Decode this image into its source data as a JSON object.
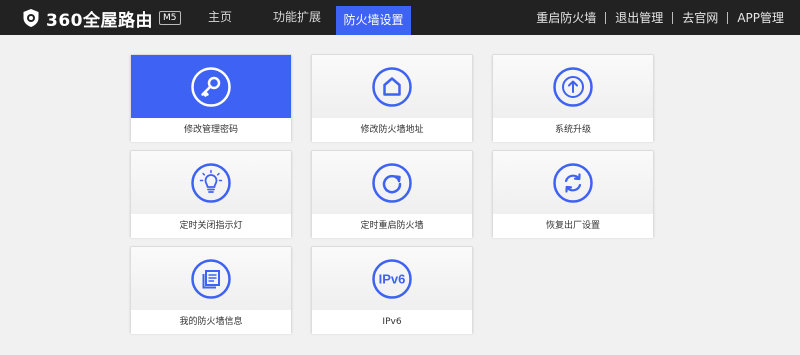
{
  "brand": {
    "name": "360全屋路由",
    "model": "M5"
  },
  "nav": {
    "items": [
      {
        "label": "主页",
        "active": false
      },
      {
        "label": "功能扩展",
        "active": false
      },
      {
        "label": "防火墙设置",
        "active": true
      }
    ]
  },
  "top_links": [
    "重启防火墙",
    "退出管理",
    "去官网",
    "APP管理"
  ],
  "tiles": [
    {
      "label": "修改管理密码",
      "icon": "key-icon",
      "active": true
    },
    {
      "label": "修改防火墙地址",
      "icon": "home-icon",
      "active": false
    },
    {
      "label": "系统升级",
      "icon": "upgrade-arrow-icon",
      "active": false
    },
    {
      "label": "定时关闭指示灯",
      "icon": "lightbulb-icon",
      "active": false
    },
    {
      "label": "定时重启防火墙",
      "icon": "refresh-icon",
      "active": false
    },
    {
      "label": "恢复出厂设置",
      "icon": "restore-icon",
      "active": false
    },
    {
      "label": "我的防火墙信息",
      "icon": "document-icon",
      "active": false
    },
    {
      "label": "IPv6",
      "icon": "ipv6-icon",
      "icon_text": "IPv6",
      "active": false
    }
  ],
  "colors": {
    "accent": "#3e62f3",
    "header_bg": "#222222",
    "page_bg": "#f1f1f1"
  }
}
